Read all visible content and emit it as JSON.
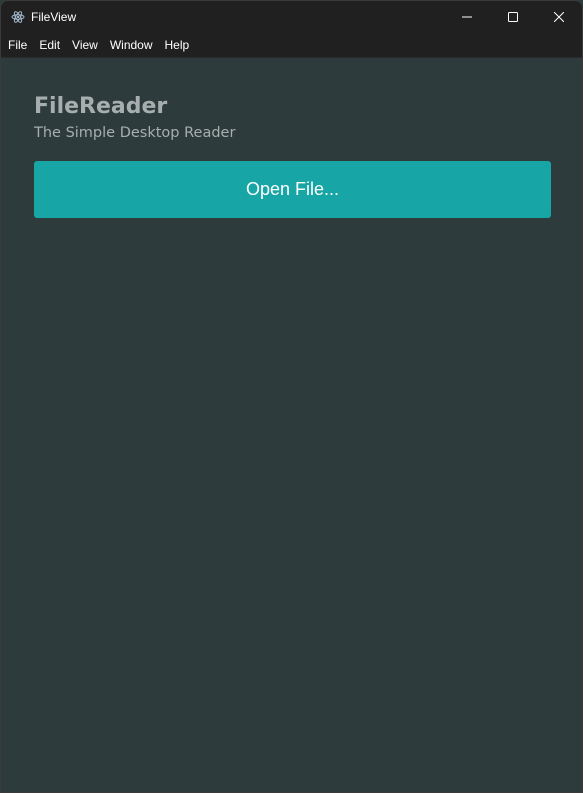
{
  "window": {
    "title": "FileView",
    "icon": "electron-atom-icon",
    "controls": [
      "minimize-icon",
      "maximize-icon",
      "close-icon"
    ]
  },
  "menu": {
    "items": [
      {
        "label": "File"
      },
      {
        "label": "Edit"
      },
      {
        "label": "View"
      },
      {
        "label": "Window"
      },
      {
        "label": "Help"
      }
    ]
  },
  "main": {
    "title": "FileReader",
    "subtitle": "The Simple Desktop Reader",
    "open_button_label": "Open File..."
  },
  "colors": {
    "background": "#2e3b3c",
    "titlebar": "#202020",
    "accent": "#17a5a5",
    "heading_text": "#a7aeae"
  }
}
